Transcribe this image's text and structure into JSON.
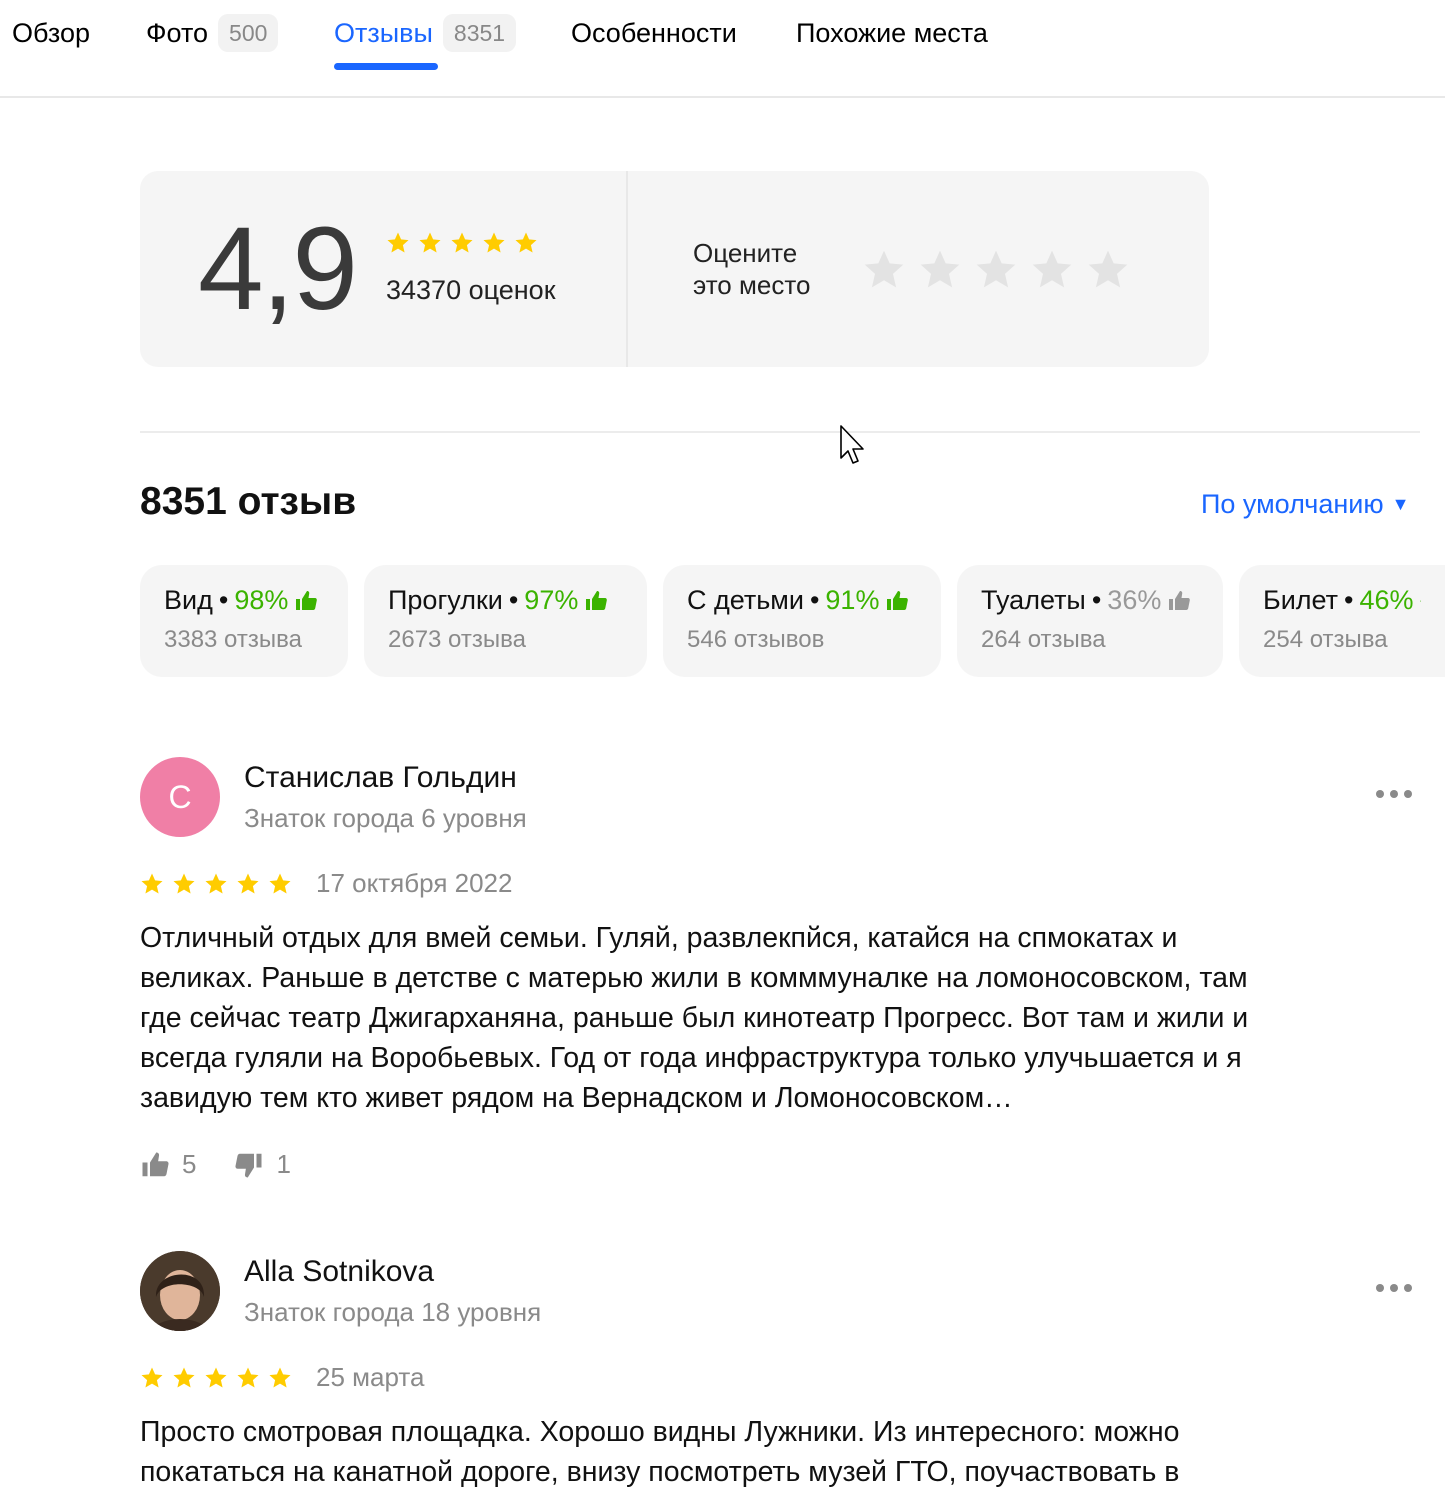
{
  "tabs": [
    {
      "label": "Обзор",
      "count": null
    },
    {
      "label": "Фото",
      "count": "500"
    },
    {
      "label": "Отзывы",
      "count": "8351"
    },
    {
      "label": "Особенности",
      "count": null
    },
    {
      "label": "Похожие места",
      "count": null
    }
  ],
  "rating": {
    "score": "4,9",
    "count_text": "34370 оценок",
    "rate_prompt_line1": "Оцените",
    "rate_prompt_line2": "это место"
  },
  "reviews_header": {
    "title": "8351 отзыв",
    "sort_label": "По умолчанию"
  },
  "aspects": [
    {
      "name": "Вид",
      "percent": "98%",
      "reviews": "3383 отзыва",
      "tone": "good"
    },
    {
      "name": "Прогулки",
      "percent": "97%",
      "reviews": "2673 отзыва",
      "tone": "good"
    },
    {
      "name": "С детьми",
      "percent": "91%",
      "reviews": "546 отзывов",
      "tone": "good"
    },
    {
      "name": "Туалеты",
      "percent": "36%",
      "reviews": "264 отзыва",
      "tone": "neutral"
    },
    {
      "name": "Билет",
      "percent": "46%",
      "reviews": "254 отзыва",
      "tone": "good"
    }
  ],
  "reviews": [
    {
      "author": "Станислав Гольдин",
      "avatar_letter": "С",
      "level": "Знаток города 6 уровня",
      "date": "17 октября 2022",
      "stars": 5,
      "text_lines": [
        "Отличный отдых для вмей семьи. Гуляй, развлекпйся, катайся на спмокатах и",
        "великах. Раньше в детстве с матерью жили в комммуналке на ломоносовском, там",
        "где сейчас театр Джигарханяна, раньше был кинотеатр Прогресс. Вот там и жили и",
        "всегда гуляли на Воробьевых. Год от года инфраструктура только улучьшается и я",
        "завидую тем кто живет рядом на Вернадском и Ломоносовском…"
      ],
      "likes": "5",
      "dislikes": "1"
    },
    {
      "author": "Alla Sotnikova",
      "level": "Знаток города 18 уровня",
      "date": "25 марта",
      "stars": 5,
      "text_lines": [
        "Просто смотровая площадка. Хорошо видны Лужники. Из интересного: можно",
        "покататься на канатной дороге, внизу посмотреть музей ГТО, поучаствовать в"
      ]
    }
  ],
  "colors": {
    "accent": "#1a66ff",
    "star": "#fc0",
    "positive": "#3bb300",
    "muted": "#8a8a8a"
  }
}
